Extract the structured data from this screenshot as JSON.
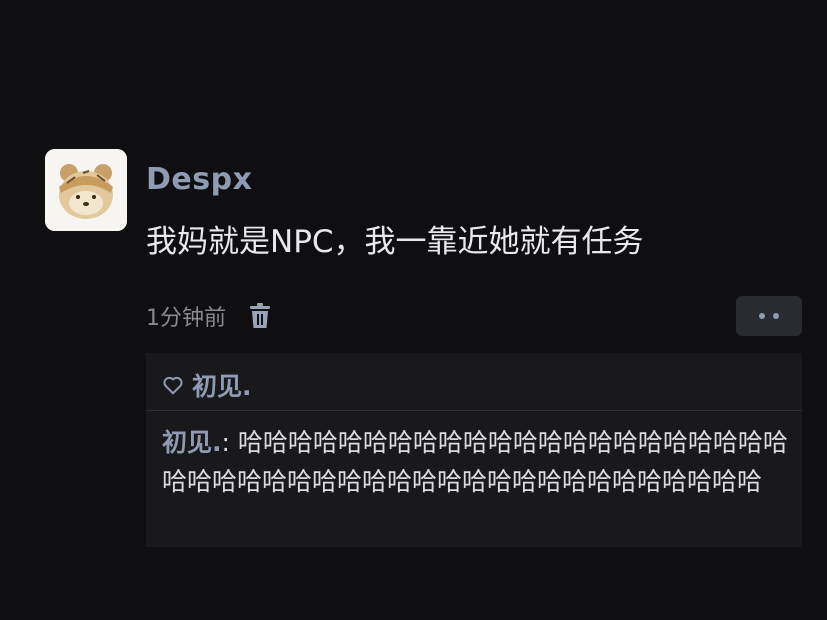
{
  "comment": {
    "username": "Despx",
    "text": "我妈就是NPC，我一靠近她就有任务",
    "time": "1分钟前"
  },
  "icons": {
    "avatar": "bear-avatar-icon",
    "delete": "trash-icon",
    "more": "more-dots-icon",
    "like": "heart-icon"
  },
  "replies": {
    "liker": "初见.",
    "author": "初见.",
    "separator": ": ",
    "text": "哈哈哈哈哈哈哈哈哈哈哈哈哈哈哈哈哈哈哈哈哈哈哈哈哈哈哈哈哈哈哈哈哈哈哈哈哈哈哈哈哈哈哈哈哈哈"
  },
  "colors": {
    "background": "#0f0f11",
    "username": "#8f9bb3",
    "text": "#e9e9ec",
    "meta": "#8a8a90",
    "reply_box": "#19191c"
  }
}
